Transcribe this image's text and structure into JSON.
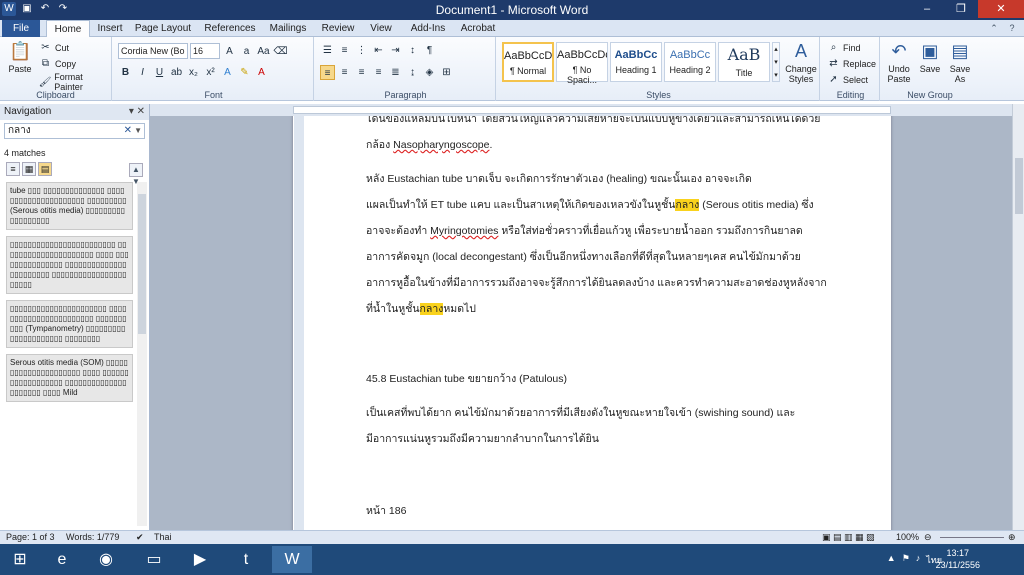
{
  "window": {
    "title": "Document1 - Microsoft Word",
    "controls": {
      "minimize": "‒",
      "restore": "❐",
      "close": "✕"
    }
  },
  "quick_access": [
    "W",
    "💾",
    "↶",
    "↷"
  ],
  "tabs": [
    "File",
    "Home",
    "Insert",
    "Page Layout",
    "References",
    "Mailings",
    "Review",
    "View",
    "Add-Ins",
    "Acrobat"
  ],
  "ribbon": {
    "clipboard": {
      "label": "Clipboard",
      "paste": "Paste",
      "cut": "Cut",
      "copy": "Copy",
      "format_painter": "Format Painter"
    },
    "font": {
      "label": "Font",
      "font_name": "Cordia New (Bo",
      "font_size": "16"
    },
    "paragraph": {
      "label": "Paragraph"
    },
    "styles": {
      "label": "Styles",
      "items": [
        {
          "sample": "AaBbCcDc",
          "name": "¶ Normal"
        },
        {
          "sample": "AaBbCcDc",
          "name": "¶ No Spaci..."
        },
        {
          "sample": "AaBbCc",
          "name": "Heading 1"
        },
        {
          "sample": "AaBbCc",
          "name": "Heading 2"
        },
        {
          "sample": "AaB",
          "name": "Title"
        }
      ],
      "change_styles": "Change Styles"
    },
    "editing": {
      "label": "Editing",
      "find": "Find",
      "replace": "Replace",
      "select": "Select"
    },
    "new_group": {
      "label": "New Group",
      "undo_paste": "Undo Paste",
      "save": "Save",
      "save_as": "Save As"
    }
  },
  "nav": {
    "title": "Navigation",
    "search": "กลาง",
    "matches": "4 matches",
    "results": [
      "tube ▯▯▯ ▯▯▯▯▯▯▯▯▯▯▯▯▯▯ ▯▯▯▯▯▯▯▯▯▯▯▯▯▯▯▯▯▯▯▯▯ ▯▯▯▯▯▯▯▯▯ (Serous otitis media) ▯▯▯▯▯▯▯▯▯▯▯▯▯▯▯▯▯▯",
      "▯▯▯▯▯▯▯▯▯▯▯▯▯▯▯▯▯▯▯▯▯▯▯▯ ▯▯▯▯▯▯▯▯▯▯▯▯▯▯▯▯▯▯▯▯▯ ▯▯▯▯ ▯▯▯▯▯▯▯▯▯▯▯▯▯▯▯ ▯▯▯▯▯▯▯▯▯▯▯▯▯▯▯▯▯▯▯▯▯▯▯ ▯▯▯▯▯▯▯▯▯▯▯▯▯▯▯▯▯▯▯▯▯▯",
      "▯▯▯▯▯▯▯▯▯▯▯▯▯▯▯▯▯▯▯▯▯▯ ▯▯▯▯▯▯▯▯▯▯▯▯▯▯▯▯▯▯▯▯▯▯▯ ▯▯▯▯▯▯▯▯▯▯ (Tympanometry) ▯▯▯▯▯▯▯▯▯▯▯▯▯▯▯▯▯▯▯▯▯ ▯▯▯▯▯▯▯▯",
      "Serous otitis media (SOM) ▯▯▯▯▯▯▯▯▯▯▯▯▯▯▯▯▯▯▯▯▯ ▯▯▯▯ ▯▯▯▯▯▯▯▯▯▯▯▯▯▯▯▯▯▯ ▯▯▯▯▯▯▯▯▯▯▯▯▯▯▯▯▯▯▯▯▯ ▯▯▯▯ Mild"
    ]
  },
  "document": {
    "lines": [
      {
        "pre": "โดนของแหลมบนใบหน้า โดยส่วนใหญ่แล้วความเสียหายจะเป็นแบบหูข้างเดียวและสามารถเห็นได้ด้วย",
        "hl": "",
        "post": ""
      },
      {
        "pre": "กล้อง ",
        "hl": "",
        "post": "",
        "ul": "Nasopharyngoscope",
        "tail": "."
      },
      {
        "pre": "        หลัง Eustachian tube บาดเจ็บ จะเกิดการรักษาตัวเอง  (healing) ขณะนั้นเอง อาจจะเกิด",
        "hl": "",
        "post": ""
      },
      {
        "pre": "แผลเป็นทำให้ ET tube แคบ และเป็นสาเหตุให้เกิดของเหลวขังในหูชั้น",
        "hl": "กลาง",
        "post": "  (Serous otitis media) ซึ่ง"
      },
      {
        "pre": "อาจจะต้องทำ ",
        "hl": "",
        "post": " หรือใส่ท่อชั่วคราวที่เยื่อแก้วหู  เพื่อระบายน้ำออก  รวมถึงการกินยาลด",
        "ul": "Myringotomies"
      },
      {
        "pre": "อาการคัดจมูก  (local decongestant) ซึ่งเป็นอีกหนึ่งทางเลือกที่ดีที่สุดในหลายๆเคส  คนไข้มักมาด้วย",
        "hl": "",
        "post": ""
      },
      {
        "pre": "อาการหูอื้อในข้างที่มีอาการรวมถึงอาจจะรู้สึกการได้ยินลดลงบ้าง  และควรทำความสะอาดช่องหูหลังจาก",
        "hl": "",
        "post": ""
      },
      {
        "pre": "ที่น้ำในหูชั้น",
        "hl": "กลาง",
        "post": "หมดไป"
      },
      {
        "pre": "45.8 Eustachian tube ขยายกว้าง  (Patulous)",
        "hl": "",
        "post": ""
      },
      {
        "pre": "        เป็นเคสที่พบได้ยาก  คนไข้มักมาด้วยอาการที่มีเสียงดังในหูขณะหายใจเข้า  (swishing sound) และ",
        "hl": "",
        "post": ""
      },
      {
        "pre": "มีอาการแน่นหูรวมถึงมีความยากลำบากในการได้ยิน",
        "hl": "",
        "post": ""
      },
      {
        "pre": "หน้า 186",
        "hl": "",
        "post": ""
      }
    ]
  },
  "status": {
    "page": "Page: 1 of 3",
    "words": "Words: 1/779",
    "language": "Thai",
    "zoom": "100%"
  },
  "taskbar": {
    "apps": [
      "windows-start-icon",
      "ie-icon",
      "chrome-icon",
      "explorer-icon",
      "media-icon",
      "torrent-icon",
      "word-icon"
    ],
    "time": "13:17",
    "date": "23/11/2556",
    "lang": "ไทย"
  }
}
